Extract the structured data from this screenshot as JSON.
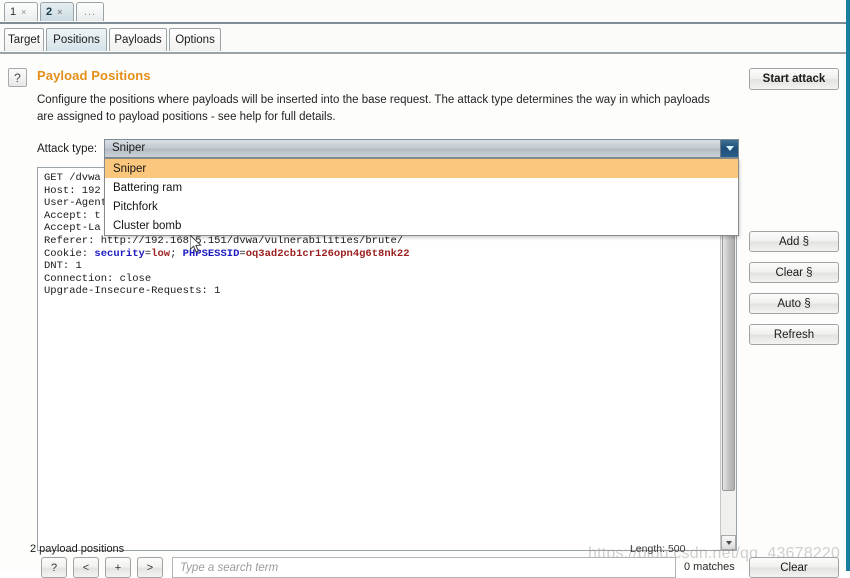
{
  "session_tabs": [
    {
      "label": "1",
      "close": "×",
      "selected": false
    },
    {
      "label": "2",
      "close": "×",
      "selected": true
    },
    {
      "label": "...",
      "selected": false
    }
  ],
  "tool_tabs": [
    {
      "label": "Target",
      "selected": false
    },
    {
      "label": "Positions",
      "selected": true
    },
    {
      "label": "Payloads",
      "selected": false
    },
    {
      "label": "Options",
      "selected": false
    }
  ],
  "header": {
    "help_icon": "?",
    "title": "Payload Positions",
    "description": "Configure the positions where payloads will be inserted into the base request. The attack type determines the way in which payloads are assigned to payload positions - see help for full details.",
    "title_color": "#e58f1a"
  },
  "attack_type": {
    "label": "Attack type:",
    "value": "Sniper",
    "options": [
      {
        "label": "Sniper",
        "selected": true
      },
      {
        "label": "Battering ram",
        "selected": false
      },
      {
        "label": "Pitchfork",
        "selected": false
      },
      {
        "label": "Cluster bomb",
        "selected": false
      }
    ],
    "dropdown_open": true,
    "highlight_color": "#fbc77d"
  },
  "request": {
    "lines": [
      {
        "text": "GET /dvwa"
      },
      {
        "text": "Host: 192"
      },
      {
        "text": "User-Agent"
      },
      {
        "text": "Accept: t"
      },
      {
        "text": "Accept-La"
      },
      {
        "text": "Referer: http://192.168.5.151/dvwa/vulnerabilities/brute/"
      },
      {
        "text": "Cookie: ",
        "tokens": [
          {
            "t": "security",
            "c": "name"
          },
          {
            "t": "=",
            "c": "plain"
          },
          {
            "t": "low",
            "c": "val"
          },
          {
            "t": "; ",
            "c": "plain"
          },
          {
            "t": "PHPSESSID",
            "c": "name"
          },
          {
            "t": "=",
            "c": "plain"
          },
          {
            "t": "oq3ad2cb1cr126opn4g6t8nk22",
            "c": "val"
          }
        ]
      },
      {
        "text": "DNT: 1"
      },
      {
        "text": "Connection: close"
      },
      {
        "text": "Upgrade-Insecure-Requests: 1"
      }
    ]
  },
  "side_buttons": {
    "start_attack": "Start attack",
    "add": "Add §",
    "clear": "Clear §",
    "auto": "Auto §",
    "refresh": "Refresh",
    "clear_search": "Clear"
  },
  "search_bar": {
    "help": "?",
    "prev": "<",
    "mid": "+",
    "next": ">",
    "placeholder": "Type a search term",
    "value": "",
    "matches": "0 matches"
  },
  "status": {
    "payload_positions": "2 payload positions",
    "length": "Length: 500"
  },
  "watermark": "https://blog.csdn.net/qq_43678220"
}
